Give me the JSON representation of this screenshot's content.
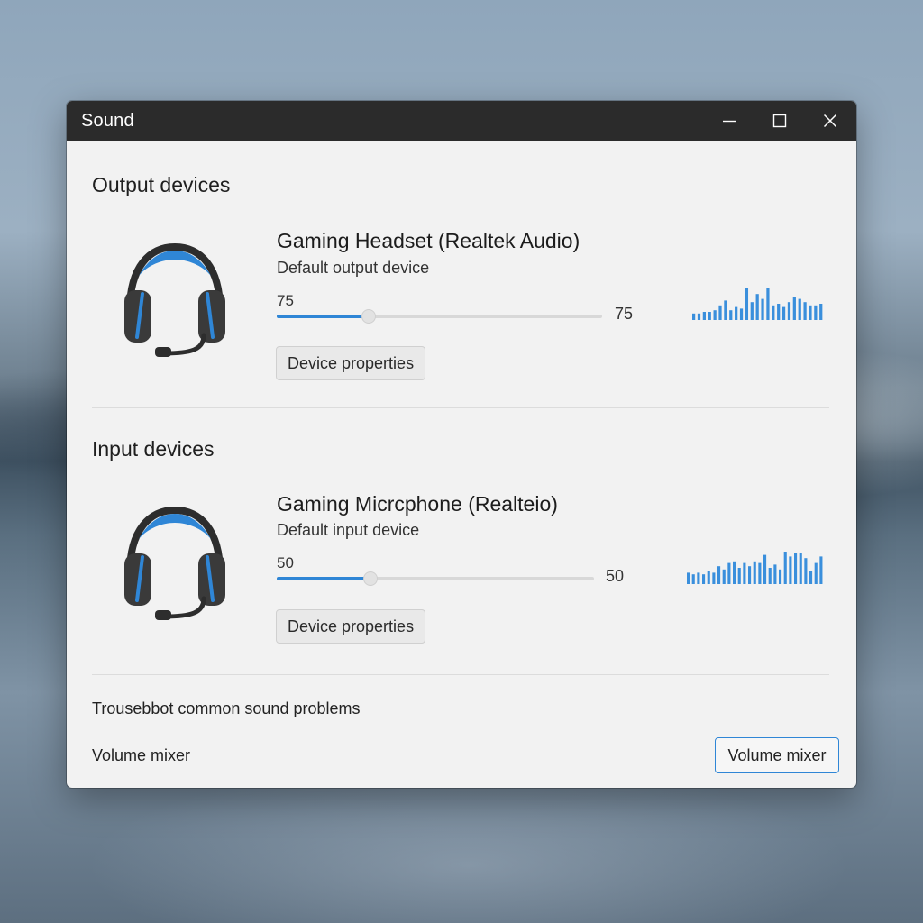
{
  "window": {
    "title": "Sound"
  },
  "output": {
    "section_title": "Output devices",
    "device_name": "Gaming Headset (Realtek Audio)",
    "device_subtitle": "Default output device",
    "volume_label": "75",
    "volume_value_label": "75",
    "volume": 75,
    "properties_button": "Device properties",
    "meter_levels": [
      0.2,
      0.2,
      0.25,
      0.25,
      0.3,
      0.45,
      0.6,
      0.3,
      0.4,
      0.35,
      1.0,
      0.55,
      0.8,
      0.65,
      1.0,
      0.45,
      0.5,
      0.4,
      0.55,
      0.7,
      0.65,
      0.55,
      0.45,
      0.45,
      0.5
    ]
  },
  "input": {
    "section_title": "Input devices",
    "device_name": "Gaming Micrcphone (Realteio)",
    "device_subtitle": "Default input device",
    "volume_label": "50",
    "volume_value_label": "50",
    "volume": 50,
    "properties_button": "Device properties",
    "meter_levels": [
      0.35,
      0.3,
      0.35,
      0.3,
      0.4,
      0.35,
      0.55,
      0.45,
      0.65,
      0.7,
      0.5,
      0.65,
      0.55,
      0.7,
      0.65,
      0.9,
      0.5,
      0.6,
      0.45,
      1.0,
      0.85,
      0.95,
      0.95,
      0.8,
      0.4,
      0.65,
      0.85
    ]
  },
  "footer": {
    "troubleshoot_text": "Trousebbot common sound problems",
    "volume_mixer_text": "Volume mixer",
    "volume_mixer_button": "Volume mixer"
  },
  "colors": {
    "accent": "#2f86d6",
    "titlebar": "#2b2b2b",
    "window_bg": "#f2f2f2",
    "meter": "#3a8fdc"
  },
  "icons": {
    "output": "headset-icon",
    "input": "headset-icon"
  }
}
